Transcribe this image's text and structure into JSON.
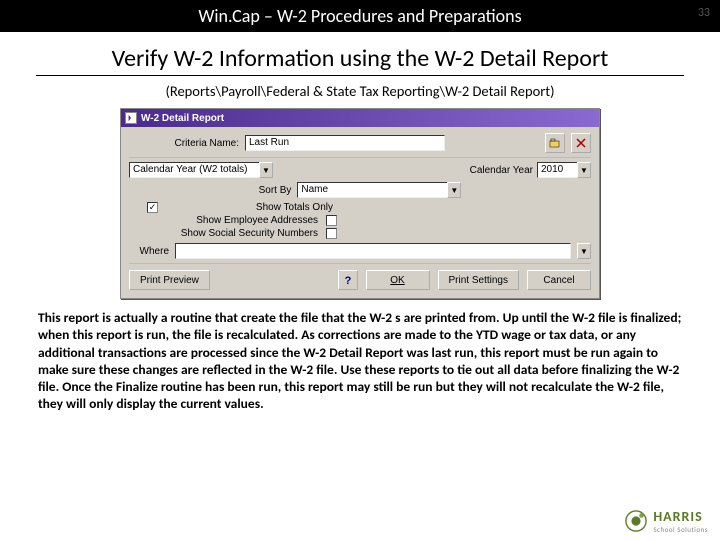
{
  "header": {
    "title": "Win.Cap – W-2 Procedures and Preparations",
    "page_number": "33"
  },
  "heading": "Verify W-2 Information using the W-2 Detail Report",
  "navpath": "(Reports\\Payroll\\Federal & State Tax Reporting\\W-2 Detail Report)",
  "dialog": {
    "title": "W-2 Detail Report",
    "criteria_label": "Criteria Name:",
    "criteria_value": "Last Run",
    "layout_label": "Calendar Year (W2 totals)",
    "cal_year_label": "Calendar Year",
    "cal_year_value": "2010",
    "sort_label": "Sort By",
    "sort_value": "Name",
    "show_totals": {
      "label": "Show Totals Only",
      "checked": "✓"
    },
    "show_addr": {
      "label": "Show Employee Addresses",
      "checked": ""
    },
    "show_ssn": {
      "label": "Show Social Security Numbers",
      "checked": ""
    },
    "where_label": "Where",
    "where_value": "",
    "buttons": {
      "print": "Print Preview",
      "ok": "OK",
      "settings": "Print Settings",
      "cancel": "Cancel"
    }
  },
  "paragraph": "This report is actually a routine that create the file that the W-2 s are printed from.  Up until the W-2 file is finalized; when this report is run, the file is recalculated.  As corrections are made to the YTD wage or tax data, or any additional transactions are processed since the W-2 Detail Report was last run, this report must be run again to make sure these changes are reflected in the W-2 file.  Use these reports to tie out all data before finalizing the W-2 file.  Once the Finalize routine has been run, this report may still be run but they will not recalculate the W-2 file, they will only display the current values.",
  "logo": {
    "line1": "HARRIS",
    "line2": "School Solutions"
  }
}
